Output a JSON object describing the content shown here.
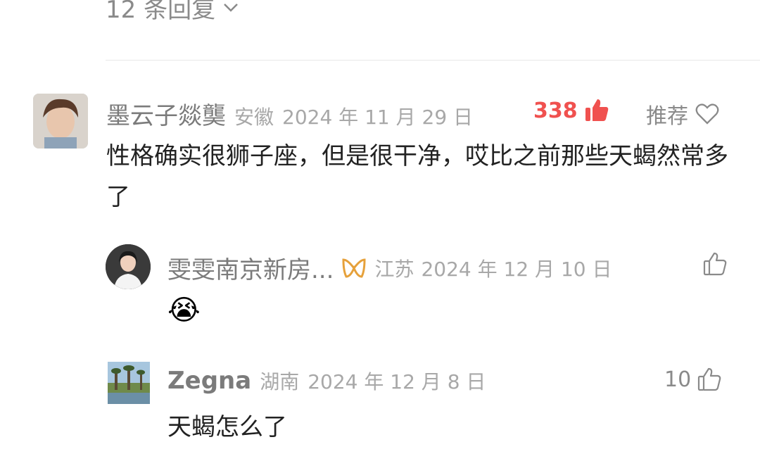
{
  "replies_toggle": {
    "label": "12 条回复",
    "icon": "chevron-down-icon"
  },
  "comments": [
    {
      "username": "墨云子燚龑",
      "location": "安徽",
      "date": "2024 年 11 月 29 日",
      "likes": "338",
      "recommend_label": "推荐",
      "text": "性格确实很狮子座，但是很干净，哎比之前那些天蝎然常多了"
    }
  ],
  "replies": [
    {
      "username": "雯雯南京新房...",
      "badge_icon": "ribbon-badge-icon",
      "location": "江苏",
      "date": "2024 年 12 月 10 日",
      "likes": "",
      "text": "😭"
    },
    {
      "username": "Zegna",
      "location": "湖南",
      "date": "2024 年 12 月 8 日",
      "likes": "10",
      "text": "天蝎怎么了"
    }
  ],
  "colors": {
    "like_active": "#f0514f",
    "muted": "#a8a8a8",
    "text": "#222222"
  }
}
